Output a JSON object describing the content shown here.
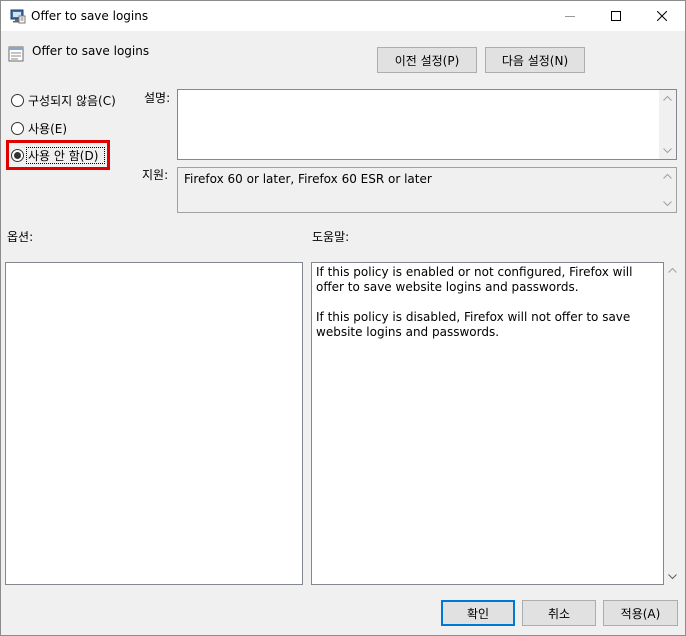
{
  "window": {
    "title": "Offer to save logins",
    "header_title": "Offer to save logins"
  },
  "nav": {
    "prev_label": "이전 설정(P)",
    "next_label": "다음 설정(N)"
  },
  "state_options": [
    {
      "label": "구성되지 않음(C)",
      "selected": false
    },
    {
      "label": "사용(E)",
      "selected": false
    },
    {
      "label": "사용 안 함(D)",
      "selected": true
    }
  ],
  "labels": {
    "description": "설명:",
    "supported_on": "지원:",
    "options": "옵션:",
    "help": "도움말:"
  },
  "description_text": "",
  "supported_text": "Firefox 60 or later, Firefox 60 ESR or later",
  "help_paragraphs": [
    "If this policy is enabled or not configured, Firefox will offer to save website logins and passwords.",
    "If this policy is disabled, Firefox will not offer to save website logins and passwords."
  ],
  "footer": {
    "ok_label": "확인",
    "cancel_label": "취소",
    "apply_label": "적용(A)"
  },
  "colors": {
    "highlight": "#e00000",
    "default_button_border": "#0078d7"
  }
}
